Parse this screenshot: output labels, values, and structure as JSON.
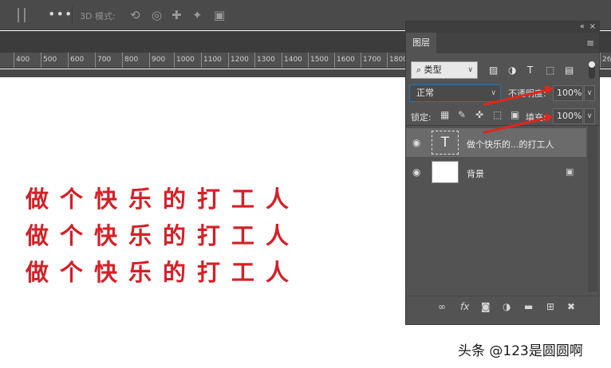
{
  "options_bar": {
    "mode_label": "3D 模式:",
    "more_label": "•••"
  },
  "ruler": {
    "ticks": [
      "400",
      "500",
      "600",
      "700",
      "800",
      "900",
      "1000",
      "1100",
      "1200",
      "1300",
      "1400",
      "1500",
      "1600",
      "1700",
      "1800",
      "26"
    ]
  },
  "canvas": {
    "lines": [
      "做个快乐的打工人",
      "做个快乐的打工人",
      "做个快乐的打工人"
    ],
    "text_color": "#d71f26"
  },
  "watermark": "头条 @123是圆圆啊",
  "layers_panel": {
    "tab_label": "图层",
    "filter": {
      "icon": "search-icon",
      "value": "类型"
    },
    "blend_mode": "正常",
    "opacity_label": "不透明度:",
    "opacity_value": "100%",
    "lock_label": "锁定:",
    "fill_label": "填充:",
    "fill_value": "100%",
    "layers": [
      {
        "name": "做个快乐的...的打工人",
        "thumb": "T",
        "selected": true,
        "visible": true
      },
      {
        "name": "背景",
        "thumb": "white",
        "selected": false,
        "visible": true,
        "locked": true
      }
    ],
    "accent_color": "#2f6fa8"
  },
  "annotation": {
    "arrow_color": "#e1261c"
  }
}
